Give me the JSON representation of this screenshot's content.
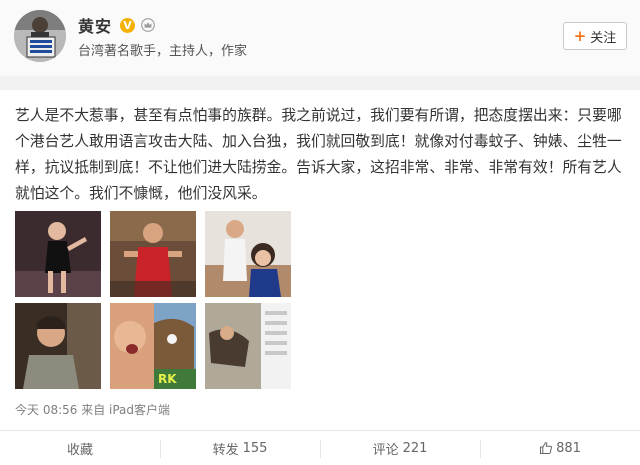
{
  "profile": {
    "name": "黄安",
    "subtitle": "台湾著名歌手，主持人，作家",
    "follow_label": "关注",
    "verified_badge": "V"
  },
  "post": {
    "text": "艺人是不大惹事，甚至有点怕事的族群。我之前说过，我们要有所谓，把态度摆出来：只要哪个港台艺人敢用语言攻击大陆、加入台独，我们就回敬到底！就像对付毒蚊子、钟婊、尘牲一样，抗议抵制到底！不让他们进大陆捞金。告诉大家，这招非常、非常、非常有效！所有艺人就怕这个。我们不慷慨，他们没风采。",
    "meta": "今天 08:56 来自 iPad客户端",
    "photo_text": "RK"
  },
  "actions": {
    "collect_label": "收藏",
    "repost_label": "转发",
    "repost_count": "155",
    "comment_label": "评论",
    "comment_count": "221",
    "like_count": "881"
  },
  "colors": {
    "accent": "#f3751b",
    "verified": "#f6b100",
    "header_bg": "#fafafa"
  }
}
